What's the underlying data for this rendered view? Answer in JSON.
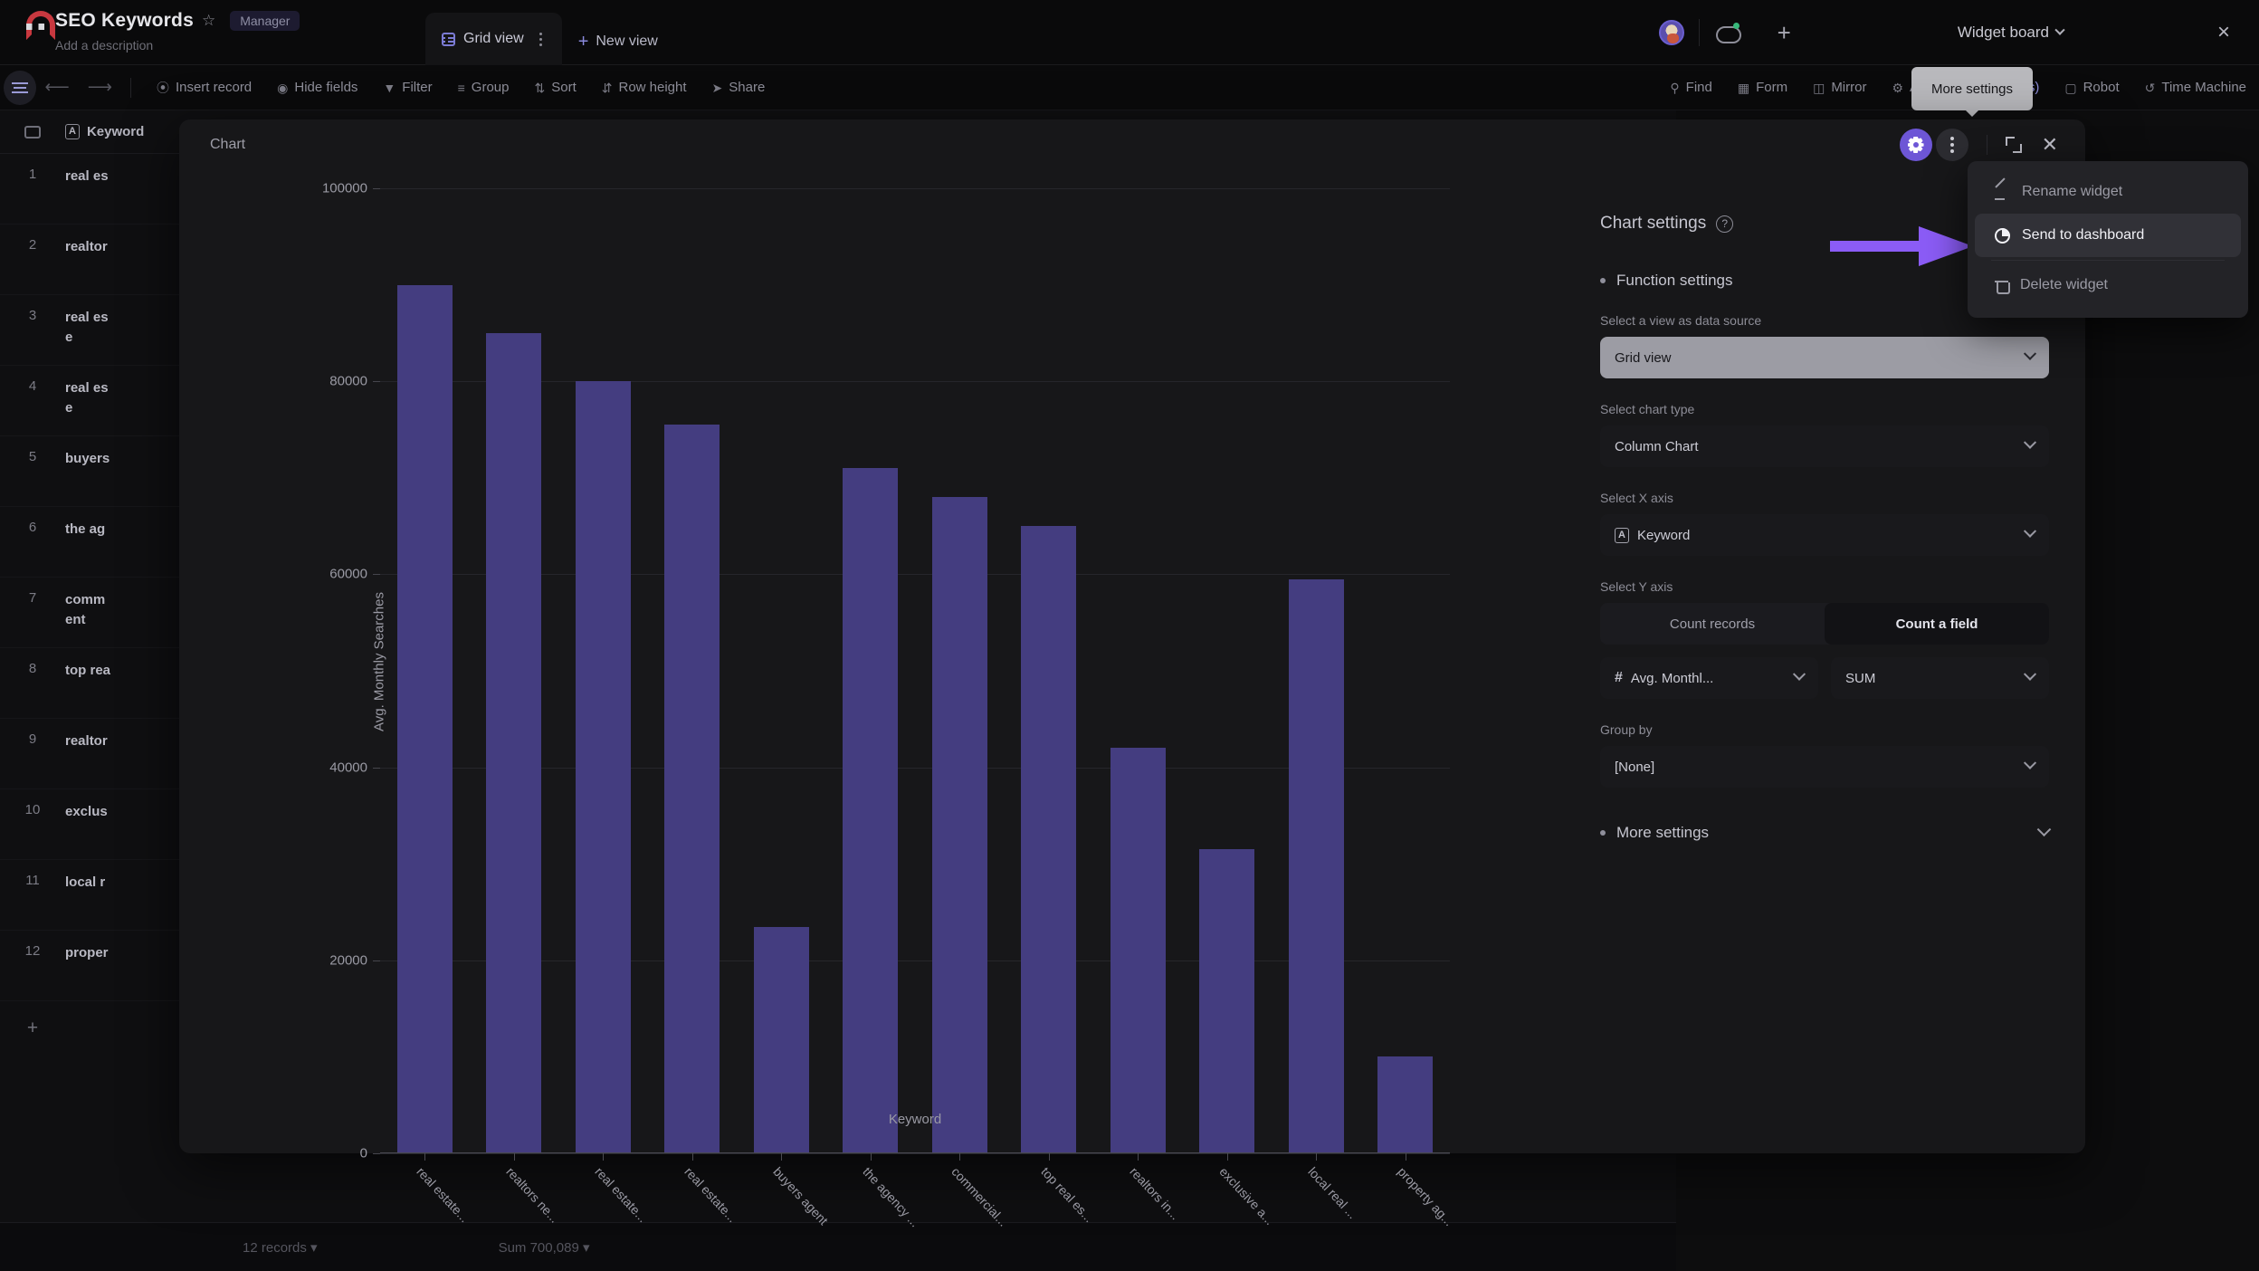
{
  "app": {
    "title": "SEO Keywords",
    "role_badge": "Manager",
    "description_placeholder": "Add a description",
    "star_icon": "star-icon",
    "magnet_icon": "magnet-icon"
  },
  "views": {
    "current": "Grid view",
    "new_view": "New view"
  },
  "toolbar": {
    "items": [
      {
        "label": "Insert record",
        "icon": "plus-circle-icon"
      },
      {
        "label": "Hide fields",
        "icon": "eye-icon"
      },
      {
        "label": "Filter",
        "icon": "funnel-icon"
      },
      {
        "label": "Group",
        "icon": "group-icon"
      },
      {
        "label": "Sort",
        "icon": "sort-icon"
      },
      {
        "label": "Row height",
        "icon": "row-height-icon"
      },
      {
        "label": "Share",
        "icon": "share-icon"
      }
    ],
    "right_items": [
      {
        "label": "Find",
        "icon": "search-icon",
        "accent": false
      },
      {
        "label": "Form",
        "icon": "form-icon",
        "accent": false
      },
      {
        "label": "Mirror",
        "icon": "mirror-icon",
        "accent": false
      },
      {
        "label": "API",
        "icon": "api-icon",
        "accent": false
      },
      {
        "label": "1 widget(s)",
        "icon": "widget-icon",
        "accent": true
      },
      {
        "label": "Robot",
        "icon": "robot-icon",
        "accent": false
      },
      {
        "label": "Time Machine",
        "icon": "time-machine-icon",
        "accent": false
      }
    ]
  },
  "header_right": {
    "add_label": "+",
    "widget_board_label": "Widget board",
    "close_label": "×"
  },
  "tooltip": {
    "more_settings": "More settings"
  },
  "grid": {
    "column_header": "Keyword",
    "rows": [
      {
        "num": "1",
        "keyword": "real es"
      },
      {
        "num": "2",
        "keyword": "realtor"
      },
      {
        "num": "3",
        "keyword": "real es\ne"
      },
      {
        "num": "4",
        "keyword": "real es\ne"
      },
      {
        "num": "5",
        "keyword": "buyers"
      },
      {
        "num": "6",
        "keyword": "the ag"
      },
      {
        "num": "7",
        "keyword": "comm\nent"
      },
      {
        "num": "8",
        "keyword": "top rea"
      },
      {
        "num": "9",
        "keyword": "realtor"
      },
      {
        "num": "10",
        "keyword": "exclus"
      },
      {
        "num": "11",
        "keyword": "local r"
      },
      {
        "num": "12",
        "keyword": "proper"
      }
    ],
    "add_row_label": "+"
  },
  "footer": {
    "records": "12 records",
    "sum": "Sum 700,089"
  },
  "modal": {
    "title": "Chart",
    "actions": {
      "gear": "gear-icon",
      "more": "more-options-icon",
      "expand": "expand-icon",
      "close": "close-icon"
    }
  },
  "context_menu": {
    "items": [
      {
        "label": "Rename widget",
        "icon": "pencil-icon",
        "highlighted": false
      },
      {
        "label": "Send to dashboard",
        "icon": "pie-chart-icon",
        "highlighted": true
      },
      {
        "label": "Delete widget",
        "icon": "trash-icon",
        "highlighted": false
      }
    ]
  },
  "settings": {
    "title": "Chart settings",
    "help_icon": "question-mark-icon",
    "function_settings": "Function settings",
    "data_source_label": "Select a view as data source",
    "data_source_value": "Grid view",
    "chart_type_label": "Select chart type",
    "chart_type_value": "Column Chart",
    "x_axis_label": "Select X axis",
    "x_axis_value": "Keyword",
    "y_axis_label": "Select Y axis",
    "y_axis_tabs": [
      "Count records",
      "Count a field"
    ],
    "y_axis_active_tab": "Count a field",
    "y_field_value": "Avg. Monthl...",
    "y_aggregate_value": "SUM",
    "group_by_label": "Group by",
    "group_by_value": "[None]",
    "more_settings": "More settings"
  },
  "colors": {
    "bar": "#443d80",
    "accent": "#8b5cf6",
    "panel_bg": "#171719",
    "page_bg": "#0d0d0e"
  },
  "chart_data": {
    "type": "bar",
    "title": "",
    "xlabel": "Keyword",
    "ylabel": "Avg. Monthly Searches",
    "ylim": [
      0,
      100000
    ],
    "yticks": [
      0,
      20000,
      40000,
      60000,
      80000,
      100000
    ],
    "ytick_labels": [
      "0",
      "20000",
      "40000",
      "60000",
      "80000",
      "100000"
    ],
    "grid": true,
    "legend": "none",
    "categories": [
      "real estate...",
      "realtors ne...",
      "real estate...",
      "real estate...",
      "buyers agent",
      "the agency ...",
      "commercial...",
      "top real es...",
      "realtors in...",
      "exclusive a...",
      "local real ...",
      "property ag..."
    ],
    "values": [
      90000,
      85000,
      80000,
      75500,
      23500,
      71000,
      68000,
      65000,
      42000,
      31500,
      59500,
      10000
    ]
  }
}
